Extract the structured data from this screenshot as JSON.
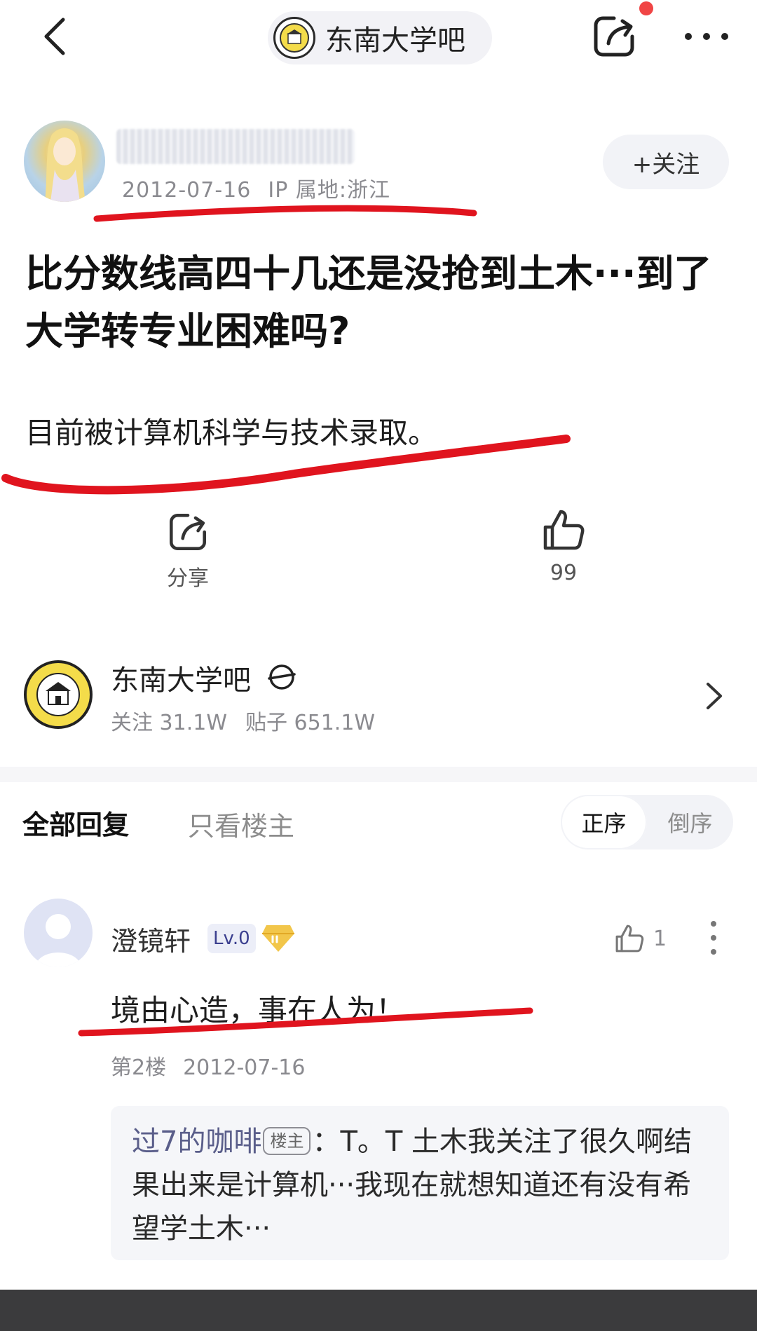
{
  "header": {
    "forum_name": "东南大学吧",
    "icons": {
      "back": "back-arrow-icon",
      "share": "share-icon",
      "more": "more-dots-icon"
    }
  },
  "author": {
    "date": "2012-07-16",
    "ip_location": "IP 属地:浙江",
    "follow_label": "+关注"
  },
  "post": {
    "title": "比分数线高四十几还是没抢到土木···到了大学转专业困难吗?",
    "body": "目前被计算机科学与技术录取。"
  },
  "actions": {
    "share_label": "分享",
    "like_count": "99"
  },
  "forum_card": {
    "name": "东南大学吧",
    "followers": "关注 31.1W",
    "posts": "贴子 651.1W"
  },
  "replies_tabs": {
    "all": "全部回复",
    "op_only": "只看楼主",
    "sort_asc": "正序",
    "sort_desc": "倒序"
  },
  "reply": {
    "username": "澄镜轩",
    "level": "Lv.0",
    "like_count": "1",
    "text": "境由心造，事在人为！",
    "floor": "第2楼",
    "date": "2012-07-16",
    "subreply": {
      "username": "过7的咖啡",
      "op_tag": "楼主",
      "text": "：T。T 土木我关注了很久啊结果出来是计算机···我现在就想知道还有没有希望学土木···"
    }
  },
  "colors": {
    "annotation_red": "#e0141e",
    "accent_gray": "#8a8a8f"
  }
}
